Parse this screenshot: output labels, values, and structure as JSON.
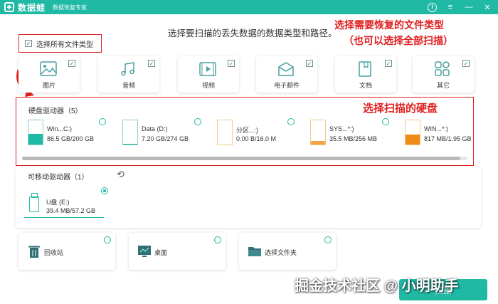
{
  "titlebar": {
    "app_name": "数据蛙",
    "subtitle": "数据恢复专家",
    "help_glyph": "!",
    "menu_glyph": "≡",
    "minimize_glyph": "—",
    "close_glyph": "✕"
  },
  "instruction": "选择要扫描的丢失数据的数据类型和路径。",
  "annotations": {
    "line1": "选择需要恢复的文件类型",
    "line2": "（也可以选择全部扫描）",
    "disk_note": "选择扫描的硬盘"
  },
  "select_all": {
    "label": "选择所有文件类型",
    "checked": true
  },
  "file_types": [
    {
      "label": "图片",
      "icon": "image-icon",
      "checked": true
    },
    {
      "label": "音频",
      "icon": "music-icon",
      "checked": true
    },
    {
      "label": "视频",
      "icon": "video-icon",
      "checked": true
    },
    {
      "label": "电子邮件",
      "icon": "email-icon",
      "checked": true
    },
    {
      "label": "文档",
      "icon": "document-icon",
      "checked": true
    },
    {
      "label": "其它",
      "icon": "other-icon",
      "checked": true
    }
  ],
  "hard_disk": {
    "title": "硬盘驱动器（5）",
    "drives": [
      {
        "name": "Win...C:)",
        "size": "86.5 GB/200 GB",
        "used_fraction": 0.43,
        "fill_color": "#1fb9a4"
      },
      {
        "name": "Data (D:)",
        "size": "7.20 GB/274 GB",
        "used_fraction": 0.03,
        "fill_color": "#1fb9a4"
      },
      {
        "name": "分区...:)",
        "size": "0.00  B/16.0 M",
        "used_fraction": 0.0,
        "fill_color": "#f3a443"
      },
      {
        "name": "SYS...*:)",
        "size": "35.5 MB/256 MB",
        "used_fraction": 0.14,
        "fill_color": "#f3a443"
      },
      {
        "name": "WIN...*:)",
        "size": "817 MB/1.95 GB",
        "used_fraction": 0.42,
        "fill_color": "#ef8c16"
      }
    ]
  },
  "removable": {
    "title": "可移动驱动器（1）",
    "refresh_glyph": "⟲",
    "drive": {
      "name": "U盘 (E:)",
      "size": "39.4 MB/57.2 GB",
      "selected": true
    }
  },
  "locations": [
    {
      "label": "回收站",
      "icon": "recycle-bin-icon"
    },
    {
      "label": "桌面",
      "icon": "desktop-icon"
    },
    {
      "label": "选择文件夹",
      "icon": "folder-icon"
    }
  ],
  "watermark": "掘金技术社区 @ 小明助手",
  "scan_button": {
    "label": "扫描"
  },
  "colors": {
    "accent": "#1fb9a4",
    "annotation": "#e02020"
  }
}
